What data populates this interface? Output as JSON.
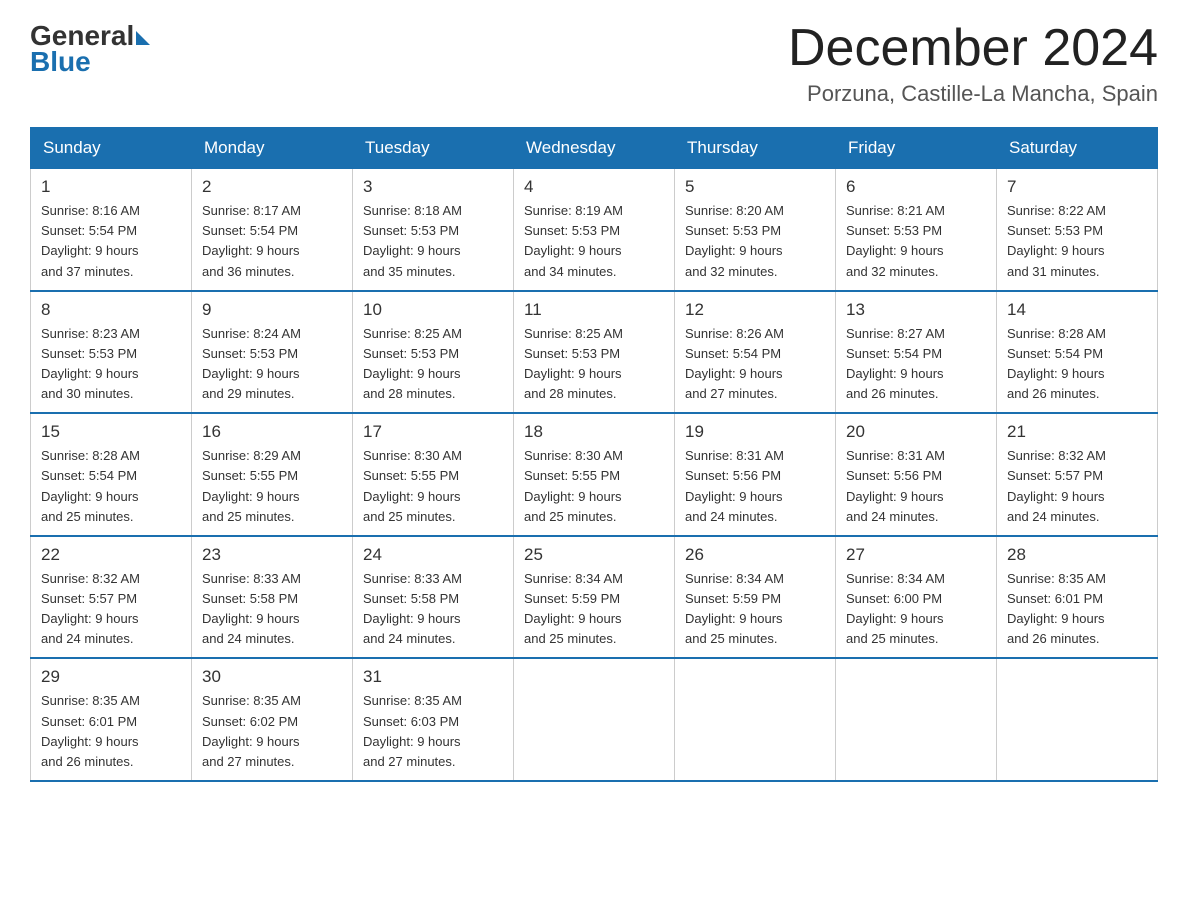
{
  "header": {
    "logo_general": "General",
    "logo_blue": "Blue",
    "month_title": "December 2024",
    "location": "Porzuna, Castille-La Mancha, Spain"
  },
  "calendar": {
    "days_of_week": [
      "Sunday",
      "Monday",
      "Tuesday",
      "Wednesday",
      "Thursday",
      "Friday",
      "Saturday"
    ],
    "weeks": [
      [
        {
          "day": "1",
          "sunrise": "8:16 AM",
          "sunset": "5:54 PM",
          "daylight": "9 hours and 37 minutes."
        },
        {
          "day": "2",
          "sunrise": "8:17 AM",
          "sunset": "5:54 PM",
          "daylight": "9 hours and 36 minutes."
        },
        {
          "day": "3",
          "sunrise": "8:18 AM",
          "sunset": "5:53 PM",
          "daylight": "9 hours and 35 minutes."
        },
        {
          "day": "4",
          "sunrise": "8:19 AM",
          "sunset": "5:53 PM",
          "daylight": "9 hours and 34 minutes."
        },
        {
          "day": "5",
          "sunrise": "8:20 AM",
          "sunset": "5:53 PM",
          "daylight": "9 hours and 32 minutes."
        },
        {
          "day": "6",
          "sunrise": "8:21 AM",
          "sunset": "5:53 PM",
          "daylight": "9 hours and 32 minutes."
        },
        {
          "day": "7",
          "sunrise": "8:22 AM",
          "sunset": "5:53 PM",
          "daylight": "9 hours and 31 minutes."
        }
      ],
      [
        {
          "day": "8",
          "sunrise": "8:23 AM",
          "sunset": "5:53 PM",
          "daylight": "9 hours and 30 minutes."
        },
        {
          "day": "9",
          "sunrise": "8:24 AM",
          "sunset": "5:53 PM",
          "daylight": "9 hours and 29 minutes."
        },
        {
          "day": "10",
          "sunrise": "8:25 AM",
          "sunset": "5:53 PM",
          "daylight": "9 hours and 28 minutes."
        },
        {
          "day": "11",
          "sunrise": "8:25 AM",
          "sunset": "5:53 PM",
          "daylight": "9 hours and 28 minutes."
        },
        {
          "day": "12",
          "sunrise": "8:26 AM",
          "sunset": "5:54 PM",
          "daylight": "9 hours and 27 minutes."
        },
        {
          "day": "13",
          "sunrise": "8:27 AM",
          "sunset": "5:54 PM",
          "daylight": "9 hours and 26 minutes."
        },
        {
          "day": "14",
          "sunrise": "8:28 AM",
          "sunset": "5:54 PM",
          "daylight": "9 hours and 26 minutes."
        }
      ],
      [
        {
          "day": "15",
          "sunrise": "8:28 AM",
          "sunset": "5:54 PM",
          "daylight": "9 hours and 25 minutes."
        },
        {
          "day": "16",
          "sunrise": "8:29 AM",
          "sunset": "5:55 PM",
          "daylight": "9 hours and 25 minutes."
        },
        {
          "day": "17",
          "sunrise": "8:30 AM",
          "sunset": "5:55 PM",
          "daylight": "9 hours and 25 minutes."
        },
        {
          "day": "18",
          "sunrise": "8:30 AM",
          "sunset": "5:55 PM",
          "daylight": "9 hours and 25 minutes."
        },
        {
          "day": "19",
          "sunrise": "8:31 AM",
          "sunset": "5:56 PM",
          "daylight": "9 hours and 24 minutes."
        },
        {
          "day": "20",
          "sunrise": "8:31 AM",
          "sunset": "5:56 PM",
          "daylight": "9 hours and 24 minutes."
        },
        {
          "day": "21",
          "sunrise": "8:32 AM",
          "sunset": "5:57 PM",
          "daylight": "9 hours and 24 minutes."
        }
      ],
      [
        {
          "day": "22",
          "sunrise": "8:32 AM",
          "sunset": "5:57 PM",
          "daylight": "9 hours and 24 minutes."
        },
        {
          "day": "23",
          "sunrise": "8:33 AM",
          "sunset": "5:58 PM",
          "daylight": "9 hours and 24 minutes."
        },
        {
          "day": "24",
          "sunrise": "8:33 AM",
          "sunset": "5:58 PM",
          "daylight": "9 hours and 24 minutes."
        },
        {
          "day": "25",
          "sunrise": "8:34 AM",
          "sunset": "5:59 PM",
          "daylight": "9 hours and 25 minutes."
        },
        {
          "day": "26",
          "sunrise": "8:34 AM",
          "sunset": "5:59 PM",
          "daylight": "9 hours and 25 minutes."
        },
        {
          "day": "27",
          "sunrise": "8:34 AM",
          "sunset": "6:00 PM",
          "daylight": "9 hours and 25 minutes."
        },
        {
          "day": "28",
          "sunrise": "8:35 AM",
          "sunset": "6:01 PM",
          "daylight": "9 hours and 26 minutes."
        }
      ],
      [
        {
          "day": "29",
          "sunrise": "8:35 AM",
          "sunset": "6:01 PM",
          "daylight": "9 hours and 26 minutes."
        },
        {
          "day": "30",
          "sunrise": "8:35 AM",
          "sunset": "6:02 PM",
          "daylight": "9 hours and 27 minutes."
        },
        {
          "day": "31",
          "sunrise": "8:35 AM",
          "sunset": "6:03 PM",
          "daylight": "9 hours and 27 minutes."
        },
        null,
        null,
        null,
        null
      ]
    ]
  }
}
